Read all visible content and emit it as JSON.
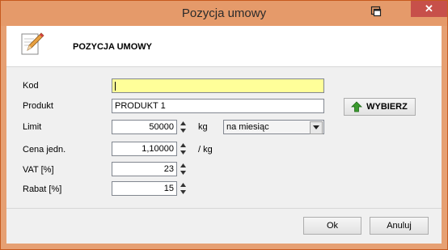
{
  "window": {
    "title": "Pozycja umowy",
    "close_glyph": "✕"
  },
  "header": {
    "title": "POZYCJA UMOWY",
    "icon": "edit-pencil-icon"
  },
  "form": {
    "kod": {
      "label": "Kod",
      "value": ""
    },
    "produkt": {
      "label": "Produkt",
      "value": "PRODUKT 1"
    },
    "wybierz_label": "WYBIERZ",
    "limit": {
      "label": "Limit",
      "value": "50000",
      "unit": "kg",
      "period": "na miesiąc"
    },
    "cena": {
      "label": "Cena jedn.",
      "value": "1,10000",
      "unit": "/ kg"
    },
    "vat": {
      "label": "VAT [%]",
      "value": "23"
    },
    "rabat": {
      "label": "Rabat [%]",
      "value": "15"
    }
  },
  "footer": {
    "ok_label": "Ok",
    "cancel_label": "Anuluj"
  },
  "colors": {
    "titlebar": "#e59a6a",
    "close": "#c7504a",
    "highlight": "#ffff99",
    "accent_green": "#3a9a2e"
  }
}
